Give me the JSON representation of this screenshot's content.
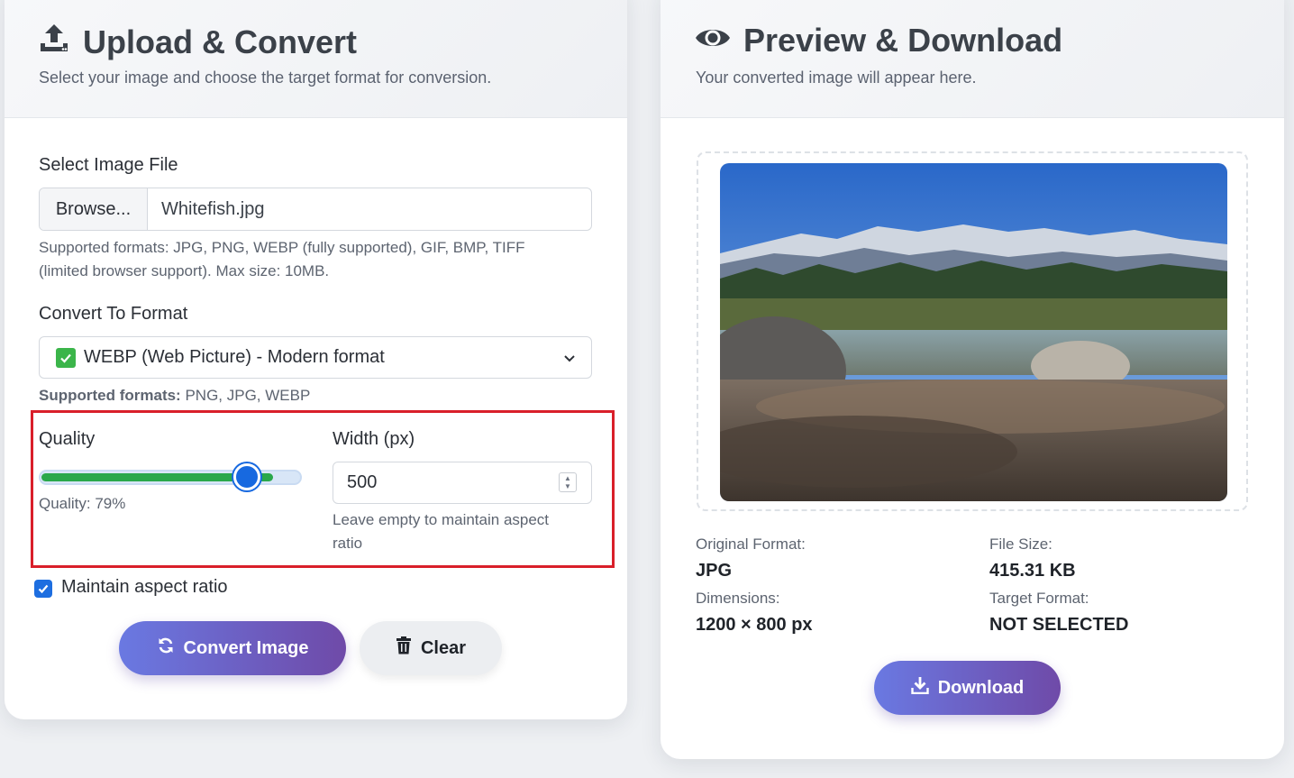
{
  "upload_card": {
    "title": "Upload & Convert",
    "subtitle": "Select your image and choose the target format for conversion.",
    "file_label": "Select Image File",
    "browse_label": "Browse...",
    "file_name": "Whitefish.jpg",
    "file_help_line1": "Supported formats: JPG, PNG, WEBP (fully supported), GIF, BMP, TIFF",
    "file_help_line2": "(limited browser support). Max size: 10MB.",
    "format_label": "Convert To Format",
    "format_selected": "WEBP (Web Picture) - Modern format",
    "format_help_bold": "Supported formats:",
    "format_help_text": " PNG, JPG, WEBP",
    "quality_label": "Quality",
    "quality_value": 79,
    "quality_text": "Quality: 79%",
    "width_label": "Width (px)",
    "width_value": "500",
    "width_help_line1": "Leave empty to maintain aspect",
    "width_help_line2": "ratio",
    "aspect_checked": true,
    "aspect_label": "Maintain aspect ratio",
    "convert_label": "Convert Image",
    "clear_label": "Clear"
  },
  "preview_card": {
    "title": "Preview & Download",
    "subtitle": "Your converted image will appear here.",
    "original_format_label": "Original Format:",
    "original_format_value": "JPG",
    "file_size_label": "File Size:",
    "file_size_value": "415.31 KB",
    "dimensions_label": "Dimensions:",
    "dimensions_value": "1200 × 800 px",
    "target_format_label": "Target Format:",
    "target_format_value": "NOT SELECTED",
    "download_label": "Download"
  },
  "icons": {
    "upload": "upload-icon",
    "eye": "eye-icon",
    "check": "check-mark-icon",
    "chevron": "chevron-down-icon",
    "sync": "sync-icon",
    "trash": "trash-icon",
    "download": "download-icon"
  },
  "colors": {
    "accent_start": "#6a79e2",
    "accent_end": "#6f4aa8",
    "slider_fill": "#2aa84a",
    "slider_thumb": "#1769e0",
    "highlight": "#d91f2a"
  }
}
